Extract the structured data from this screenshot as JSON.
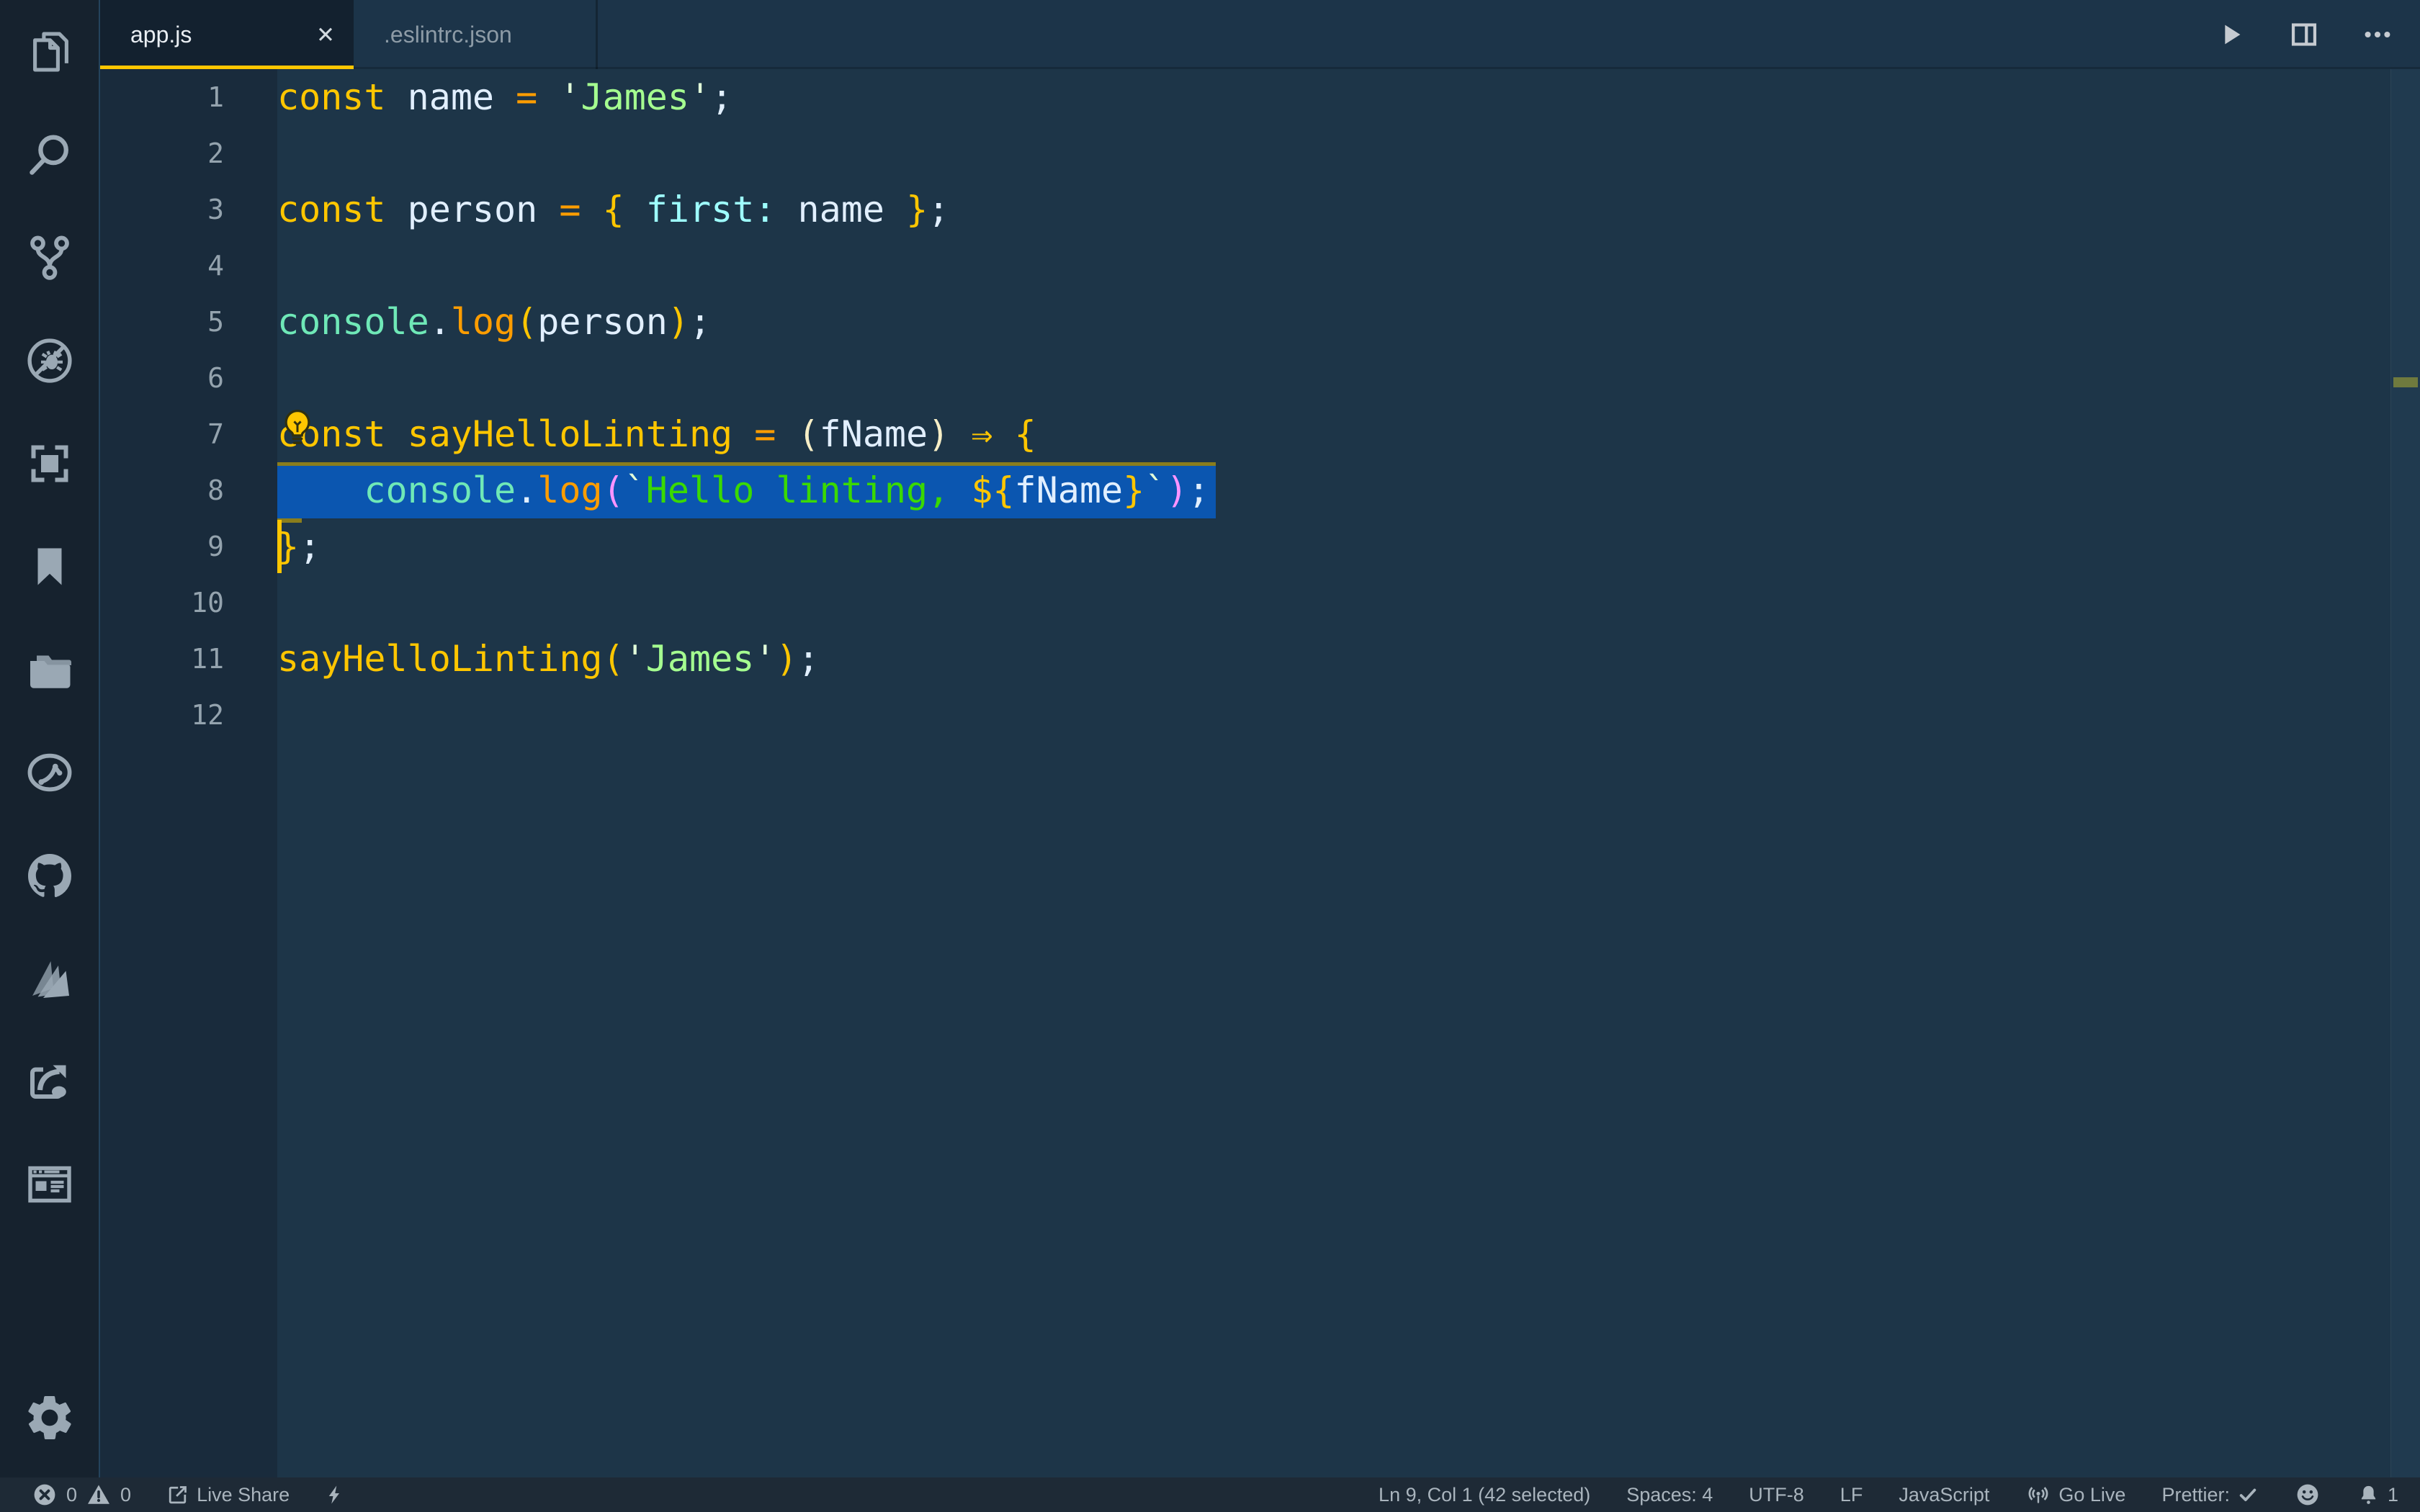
{
  "tabs": [
    {
      "label": "app.js",
      "close_glyph": "✕",
      "active": true
    },
    {
      "label": ".eslintrc.json",
      "active": false
    }
  ],
  "editor_actions": {
    "icons": [
      "run-icon",
      "split-editor-icon",
      "more-actions-icon"
    ]
  },
  "activity_bar": {
    "icons": [
      "files",
      "search",
      "source-control",
      "debug-disabled",
      "screenshot-frame",
      "bookmarks",
      "project-folders",
      "code-circle",
      "github",
      "paper-stack",
      "share-export",
      "browser-preview",
      "settings-gear"
    ]
  },
  "code": {
    "language": "JavaScript",
    "selected_line": 8,
    "cursor_line": 9,
    "lines": [
      {
        "n": 1,
        "tokens": [
          [
            "const",
            "kw"
          ],
          [
            " ",
            "plain"
          ],
          [
            "name",
            "var"
          ],
          [
            " ",
            "plain"
          ],
          [
            "=",
            "op"
          ],
          [
            " ",
            "plain"
          ],
          [
            "'",
            "quote"
          ],
          [
            "James",
            "str"
          ],
          [
            "'",
            "quote"
          ],
          [
            ";",
            "punct"
          ]
        ]
      },
      {
        "n": 2,
        "tokens": []
      },
      {
        "n": 3,
        "tokens": [
          [
            "const",
            "kw"
          ],
          [
            " ",
            "plain"
          ],
          [
            "person",
            "var"
          ],
          [
            " ",
            "plain"
          ],
          [
            "=",
            "op"
          ],
          [
            " ",
            "plain"
          ],
          [
            "{",
            "gold"
          ],
          [
            " ",
            "plain"
          ],
          [
            "first:",
            "cyan"
          ],
          [
            " ",
            "plain"
          ],
          [
            "name",
            "var"
          ],
          [
            " ",
            "plain"
          ],
          [
            "}",
            "gold"
          ],
          [
            ";",
            "punct"
          ]
        ]
      },
      {
        "n": 4,
        "tokens": []
      },
      {
        "n": 5,
        "tokens": [
          [
            "console",
            "mint"
          ],
          [
            ".",
            "punct"
          ],
          [
            "log",
            "op"
          ],
          [
            "(",
            "gold"
          ],
          [
            "person",
            "var"
          ],
          [
            ")",
            "gold"
          ],
          [
            ";",
            "punct"
          ]
        ]
      },
      {
        "n": 6,
        "tokens": []
      },
      {
        "n": 7,
        "lightbulb": true,
        "tokens": [
          [
            "const",
            "kw"
          ],
          [
            " ",
            "plain"
          ],
          [
            "sayHelloLinting",
            "fn"
          ],
          [
            " ",
            "plain"
          ],
          [
            "=",
            "op"
          ],
          [
            " ",
            "plain"
          ],
          [
            "(",
            "cream"
          ],
          [
            "fName",
            "var"
          ],
          [
            ")",
            "cream"
          ],
          [
            " ",
            "plain"
          ],
          [
            "⇒",
            "gold"
          ],
          [
            " ",
            "plain"
          ],
          [
            "{",
            "gold"
          ]
        ]
      },
      {
        "n": 8,
        "selected": true,
        "tokens": [
          [
            "    ",
            "plain"
          ],
          [
            "console",
            "mint"
          ],
          [
            ".",
            "punct"
          ],
          [
            "log",
            "op"
          ],
          [
            "(",
            "pink"
          ],
          [
            "`",
            "quote"
          ],
          [
            "Hello linting, ",
            "tpl"
          ],
          [
            "${",
            "gold"
          ],
          [
            "fName",
            "var"
          ],
          [
            "}",
            "gold"
          ],
          [
            "`",
            "quote"
          ],
          [
            ")",
            "pink"
          ],
          [
            ";",
            "punct"
          ]
        ]
      },
      {
        "n": 9,
        "cursor": true,
        "sel_end_tick": true,
        "tokens": [
          [
            "}",
            "gold"
          ],
          [
            ";",
            "punct"
          ]
        ]
      },
      {
        "n": 10,
        "tokens": []
      },
      {
        "n": 11,
        "tokens": [
          [
            "sayHelloLinting",
            "fn"
          ],
          [
            "(",
            "gold"
          ],
          [
            "'",
            "quote"
          ],
          [
            "James",
            "str"
          ],
          [
            "'",
            "quote"
          ],
          [
            ")",
            "gold"
          ],
          [
            ";",
            "punct"
          ]
        ]
      },
      {
        "n": 12,
        "tokens": []
      }
    ]
  },
  "status_bar": {
    "left": {
      "errors": "0",
      "warnings": "0",
      "live_share": "Live Share"
    },
    "right": {
      "cursor": "Ln 9, Col 1 (42 selected)",
      "indent": "Spaces: 4",
      "encoding": "UTF-8",
      "eol": "LF",
      "language": "JavaScript",
      "go_live": "Go Live",
      "prettier": "Prettier:",
      "bell_count": "1"
    }
  },
  "colors": {
    "c-activity-bg": "#16222e",
    "c-activity-border": "#24435c",
    "c-tabbar-bg": "#1c3449",
    "c-tab-active-bg": "#13212f",
    "c-tab-active-fg": "#e9eef3",
    "c-tab-inactive-fg": "#8d9ba6",
    "c-accent": "#ffc600",
    "c-editor-bg": "#1d3548",
    "c-gutter-bg": "#192b3c",
    "c-linenum": "#94a3ae",
    "c-overview-bg": "#203a4f",
    "c-overview-marker": "#6f7a3e",
    "c-sel": "#0b56b0",
    "c-sel-border": "#8a7d1c",
    "c-status-bg": "#1e2a36",
    "c-status-fg": "#a9b4bd",
    "c-icon": "#9aa8b4",
    "c-topicon": "#c6cbd1",
    "tok-kw": "#ffc600",
    "tok-fn": "#ffc600",
    "tok-var": "#e1efff",
    "tok-op": "#ff9d00",
    "tok-gold": "#ffc600",
    "tok-punct": "#e1efff",
    "tok-mint": "#6fe8b7",
    "tok-cyan": "#9effff",
    "tok-str": "#a5ff90",
    "tok-quote": "#e2ffd9",
    "tok-tpl": "#3ad900",
    "tok-pink": "#fb94ff",
    "tok-cream": "#f6eec6"
  }
}
